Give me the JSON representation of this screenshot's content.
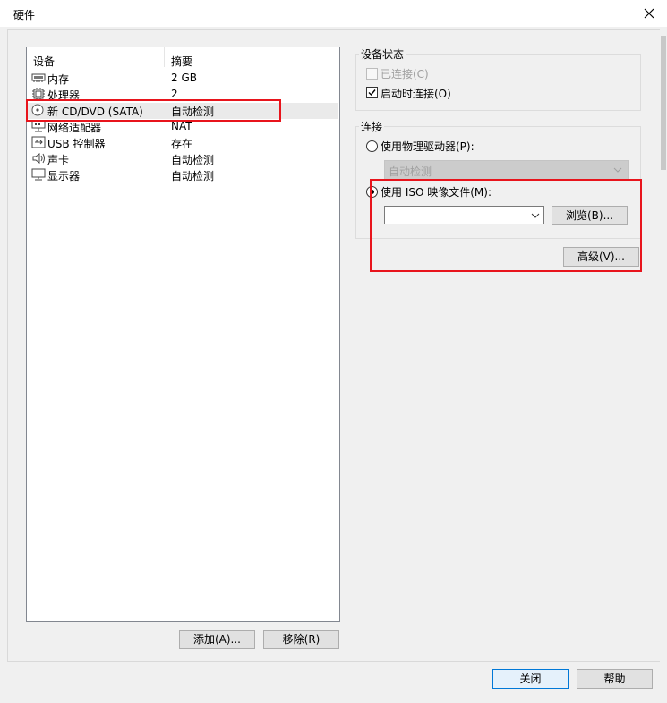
{
  "window": {
    "title": "硬件"
  },
  "device_table": {
    "columns": [
      "设备",
      "摘要"
    ],
    "rows": [
      {
        "name": "内存",
        "summary": "2 GB",
        "icon": "memory-icon"
      },
      {
        "name": "处理器",
        "summary": "2",
        "icon": "cpu-icon"
      },
      {
        "name": "新 CD/DVD (SATA)",
        "summary": "自动检测",
        "icon": "cd-dvd-icon"
      },
      {
        "name": "网络适配器",
        "summary": "NAT",
        "icon": "network-adapter-icon"
      },
      {
        "name": "USB 控制器",
        "summary": "存在",
        "icon": "usb-icon"
      },
      {
        "name": "声卡",
        "summary": "自动检测",
        "icon": "sound-icon"
      },
      {
        "name": "显示器",
        "summary": "自动检测",
        "icon": "monitor-icon"
      }
    ],
    "selected_index": 2
  },
  "list_buttons": {
    "add": "添加(A)...",
    "remove": "移除(R)"
  },
  "device_status": {
    "title": "设备状态",
    "connected": {
      "label": "已连接(C)",
      "checked": false,
      "enabled": false
    },
    "connect_on_power": {
      "label": "启动时连接(O)",
      "checked": true
    }
  },
  "connection": {
    "title": "连接",
    "physical_drive": {
      "label": "使用物理驱动器(P):",
      "selected": false
    },
    "drive_select": {
      "value": "自动检测",
      "enabled": false
    },
    "iso_image": {
      "label": "使用 ISO 映像文件(M):",
      "selected": true
    },
    "iso_path": {
      "value": ""
    },
    "browse": "浏览(B)..."
  },
  "advanced": "高级(V)...",
  "footer": {
    "close": "关闭",
    "help": "帮助"
  },
  "colors": {
    "highlight_box": "#e8141c",
    "focus_border": "#0078d7"
  }
}
